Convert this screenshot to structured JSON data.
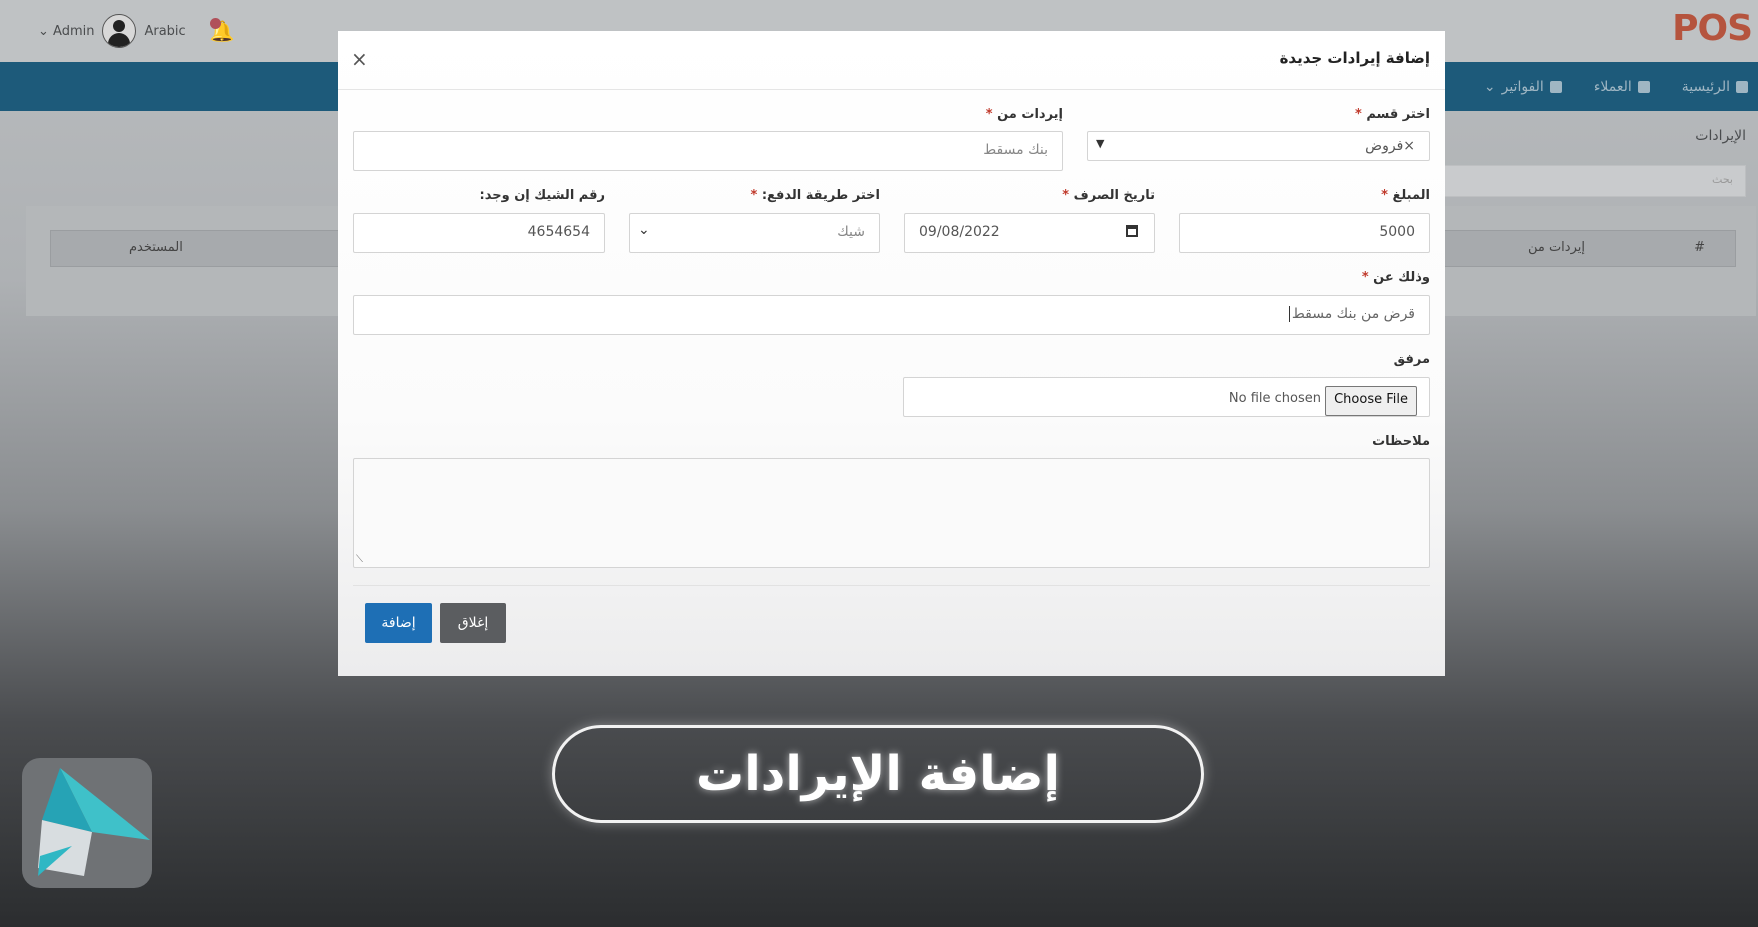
{
  "header": {
    "user_name": "Admin",
    "language": "Arabic",
    "logo_text": "POS"
  },
  "nav": {
    "items": [
      "الرئيسية",
      "العملاء",
      "الفواتير"
    ]
  },
  "background": {
    "page_title": "الإيرادات",
    "search_placeholder": "بحث",
    "table_headers": [
      "#",
      "إيردات من",
      "المستخدم"
    ]
  },
  "modal": {
    "title": "إضافة إيرادات جديدة",
    "close_symbol": "×",
    "category": {
      "label": "اختر قسم",
      "value": "×فروض"
    },
    "income_from": {
      "label": "إيردات من",
      "value": "بنك مسقط"
    },
    "amount": {
      "label": "المبلغ",
      "value": "5000"
    },
    "date": {
      "label": "تاريخ الصرف",
      "value": "09/08/2022"
    },
    "payment_method": {
      "label": "اختر طريقة الدفع:",
      "value": "شيك"
    },
    "cheque_number": {
      "label": "رقم الشيك إن وجد:",
      "value": "4654654"
    },
    "description": {
      "label": "وذلك عن",
      "value": "قرض من بنك مسقط"
    },
    "attachment": {
      "label": "مرفق",
      "button": "Choose File",
      "status": "No file chosen"
    },
    "notes": {
      "label": "ملاحظات",
      "value": ""
    },
    "required_mark": "*",
    "buttons": {
      "add": "إضافة",
      "close": "إغلاق"
    }
  },
  "caption": {
    "text": "إضافة الإيرادات"
  },
  "colors": {
    "navbar": "#1d5a7a",
    "primary_button": "#1e6fb5",
    "secondary_button": "#5b5d60",
    "required": "#c0392b"
  }
}
